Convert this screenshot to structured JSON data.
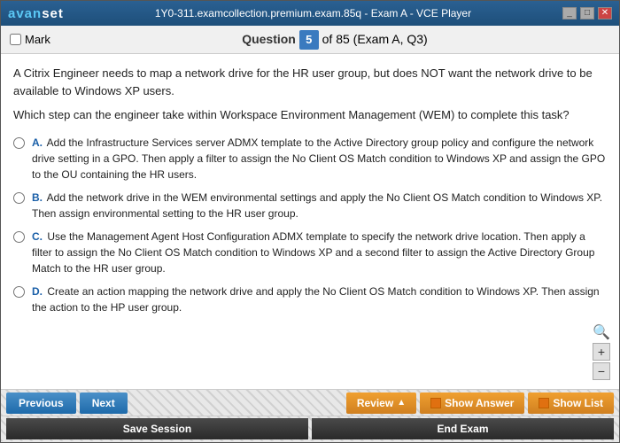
{
  "titleBar": {
    "logo": "avanset",
    "title": "1Y0-311.examcollection.premium.exam.85q - Exam A - VCE Player",
    "winButtons": [
      "minimize",
      "maximize",
      "close"
    ]
  },
  "header": {
    "markLabel": "Mark",
    "questionLabel": "Question",
    "questionNum": "5",
    "questionTotal": "of 85 (Exam A, Q3)"
  },
  "question": {
    "context": "A Citrix Engineer needs to map a network drive for the HR user group, but does NOT want the network drive to be available to Windows XP users.",
    "task": "Which step can the engineer take within Workspace Environment Management (WEM) to complete this task?",
    "options": [
      {
        "letter": "A.",
        "text": "Add the Infrastructure Services server ADMX template to the Active Directory group policy and configure the network drive setting in a GPO. Then apply a filter to assign the No Client OS Match condition to Windows XP and assign the GPO to the OU containing the HR users."
      },
      {
        "letter": "B.",
        "text": "Add the network drive in the WEM environmental settings and apply the No Client OS Match condition to Windows XP. Then assign environmental setting to the HR user group."
      },
      {
        "letter": "C.",
        "text": "Use the Management Agent Host Configuration ADMX template to specify the network drive location. Then apply a filter to assign the No Client OS Match condition to Windows XP and a second filter to assign the Active Directory Group Match to the HR user group."
      },
      {
        "letter": "D.",
        "text": "Create an action mapping the network drive and apply the No Client OS Match condition to Windows XP. Then assign the action to the HP user group."
      }
    ]
  },
  "bottomBar": {
    "prevLabel": "Previous",
    "nextLabel": "Next",
    "reviewLabel": "Review",
    "showAnswerLabel": "Show Answer",
    "showListLabel": "Show List",
    "saveSessionLabel": "Save Session",
    "endExamLabel": "End Exam"
  },
  "zoom": {
    "searchIcon": "🔍",
    "plusLabel": "+",
    "minusLabel": "−"
  }
}
